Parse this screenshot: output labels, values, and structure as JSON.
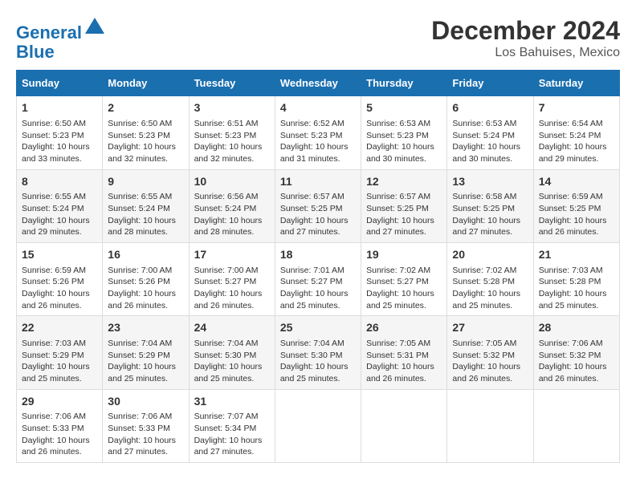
{
  "logo": {
    "line1": "General",
    "line2": "Blue"
  },
  "title": "December 2024",
  "subtitle": "Los Bahuises, Mexico",
  "days_header": [
    "Sunday",
    "Monday",
    "Tuesday",
    "Wednesday",
    "Thursday",
    "Friday",
    "Saturday"
  ],
  "weeks": [
    [
      {
        "day": "1",
        "content": "Sunrise: 6:50 AM\nSunset: 5:23 PM\nDaylight: 10 hours\nand 33 minutes."
      },
      {
        "day": "2",
        "content": "Sunrise: 6:50 AM\nSunset: 5:23 PM\nDaylight: 10 hours\nand 32 minutes."
      },
      {
        "day": "3",
        "content": "Sunrise: 6:51 AM\nSunset: 5:23 PM\nDaylight: 10 hours\nand 32 minutes."
      },
      {
        "day": "4",
        "content": "Sunrise: 6:52 AM\nSunset: 5:23 PM\nDaylight: 10 hours\nand 31 minutes."
      },
      {
        "day": "5",
        "content": "Sunrise: 6:53 AM\nSunset: 5:23 PM\nDaylight: 10 hours\nand 30 minutes."
      },
      {
        "day": "6",
        "content": "Sunrise: 6:53 AM\nSunset: 5:24 PM\nDaylight: 10 hours\nand 30 minutes."
      },
      {
        "day": "7",
        "content": "Sunrise: 6:54 AM\nSunset: 5:24 PM\nDaylight: 10 hours\nand 29 minutes."
      }
    ],
    [
      {
        "day": "8",
        "content": "Sunrise: 6:55 AM\nSunset: 5:24 PM\nDaylight: 10 hours\nand 29 minutes."
      },
      {
        "day": "9",
        "content": "Sunrise: 6:55 AM\nSunset: 5:24 PM\nDaylight: 10 hours\nand 28 minutes."
      },
      {
        "day": "10",
        "content": "Sunrise: 6:56 AM\nSunset: 5:24 PM\nDaylight: 10 hours\nand 28 minutes."
      },
      {
        "day": "11",
        "content": "Sunrise: 6:57 AM\nSunset: 5:25 PM\nDaylight: 10 hours\nand 27 minutes."
      },
      {
        "day": "12",
        "content": "Sunrise: 6:57 AM\nSunset: 5:25 PM\nDaylight: 10 hours\nand 27 minutes."
      },
      {
        "day": "13",
        "content": "Sunrise: 6:58 AM\nSunset: 5:25 PM\nDaylight: 10 hours\nand 27 minutes."
      },
      {
        "day": "14",
        "content": "Sunrise: 6:59 AM\nSunset: 5:25 PM\nDaylight: 10 hours\nand 26 minutes."
      }
    ],
    [
      {
        "day": "15",
        "content": "Sunrise: 6:59 AM\nSunset: 5:26 PM\nDaylight: 10 hours\nand 26 minutes."
      },
      {
        "day": "16",
        "content": "Sunrise: 7:00 AM\nSunset: 5:26 PM\nDaylight: 10 hours\nand 26 minutes."
      },
      {
        "day": "17",
        "content": "Sunrise: 7:00 AM\nSunset: 5:27 PM\nDaylight: 10 hours\nand 26 minutes."
      },
      {
        "day": "18",
        "content": "Sunrise: 7:01 AM\nSunset: 5:27 PM\nDaylight: 10 hours\nand 25 minutes."
      },
      {
        "day": "19",
        "content": "Sunrise: 7:02 AM\nSunset: 5:27 PM\nDaylight: 10 hours\nand 25 minutes."
      },
      {
        "day": "20",
        "content": "Sunrise: 7:02 AM\nSunset: 5:28 PM\nDaylight: 10 hours\nand 25 minutes."
      },
      {
        "day": "21",
        "content": "Sunrise: 7:03 AM\nSunset: 5:28 PM\nDaylight: 10 hours\nand 25 minutes."
      }
    ],
    [
      {
        "day": "22",
        "content": "Sunrise: 7:03 AM\nSunset: 5:29 PM\nDaylight: 10 hours\nand 25 minutes."
      },
      {
        "day": "23",
        "content": "Sunrise: 7:04 AM\nSunset: 5:29 PM\nDaylight: 10 hours\nand 25 minutes."
      },
      {
        "day": "24",
        "content": "Sunrise: 7:04 AM\nSunset: 5:30 PM\nDaylight: 10 hours\nand 25 minutes."
      },
      {
        "day": "25",
        "content": "Sunrise: 7:04 AM\nSunset: 5:30 PM\nDaylight: 10 hours\nand 25 minutes."
      },
      {
        "day": "26",
        "content": "Sunrise: 7:05 AM\nSunset: 5:31 PM\nDaylight: 10 hours\nand 26 minutes."
      },
      {
        "day": "27",
        "content": "Sunrise: 7:05 AM\nSunset: 5:32 PM\nDaylight: 10 hours\nand 26 minutes."
      },
      {
        "day": "28",
        "content": "Sunrise: 7:06 AM\nSunset: 5:32 PM\nDaylight: 10 hours\nand 26 minutes."
      }
    ],
    [
      {
        "day": "29",
        "content": "Sunrise: 7:06 AM\nSunset: 5:33 PM\nDaylight: 10 hours\nand 26 minutes."
      },
      {
        "day": "30",
        "content": "Sunrise: 7:06 AM\nSunset: 5:33 PM\nDaylight: 10 hours\nand 27 minutes."
      },
      {
        "day": "31",
        "content": "Sunrise: 7:07 AM\nSunset: 5:34 PM\nDaylight: 10 hours\nand 27 minutes."
      },
      {
        "day": "",
        "content": ""
      },
      {
        "day": "",
        "content": ""
      },
      {
        "day": "",
        "content": ""
      },
      {
        "day": "",
        "content": ""
      }
    ]
  ]
}
